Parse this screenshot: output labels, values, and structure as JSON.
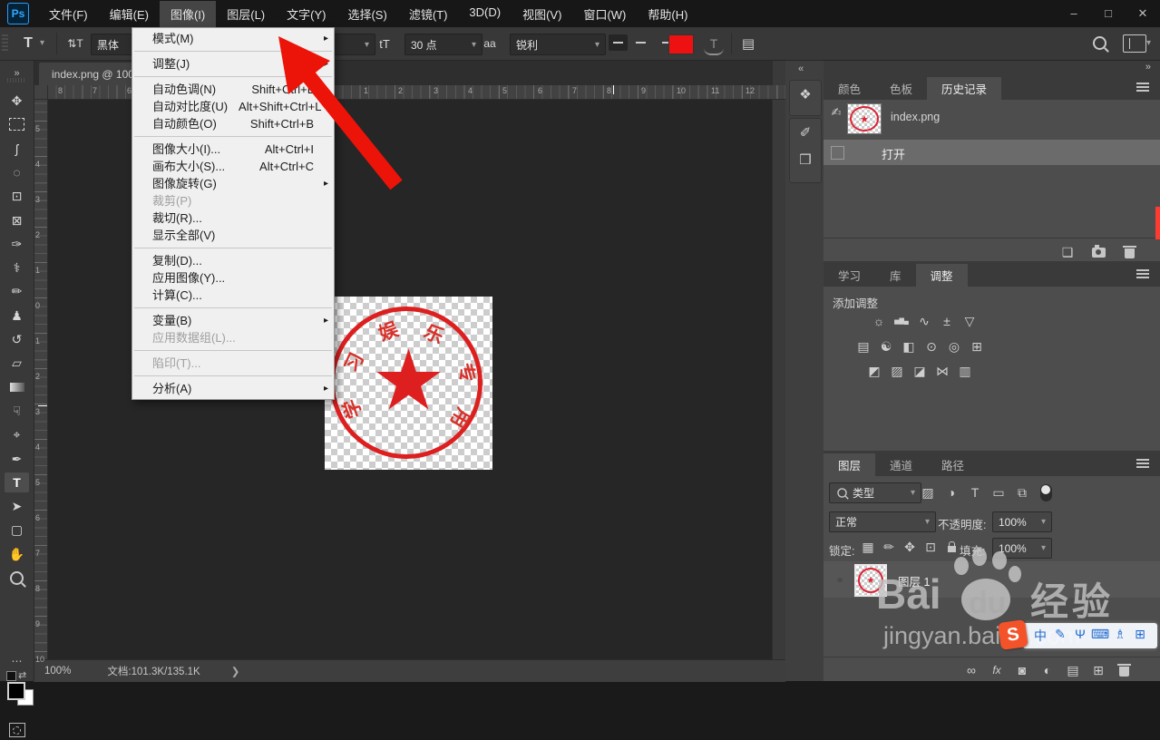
{
  "glyphs": {
    "chevron_down": "▾",
    "submenu_arrow": "▸",
    "dock_collapse": "«",
    "dock_expand": "»",
    "toolbar_collapse": "»",
    "ellipsis": "⋯",
    "swap": "⇄",
    "status_chevron": "❯"
  },
  "menubar": {
    "logo": "Ps",
    "items": [
      "文件(F)",
      "编辑(E)",
      "图像(I)",
      "图层(L)",
      "文字(Y)",
      "选择(S)",
      "滤镜(T)",
      "3D(D)",
      "视图(V)",
      "窗口(W)",
      "帮助(H)"
    ],
    "active_index": 2,
    "window_controls": {
      "minimize": "–",
      "maximize": "□",
      "close": "✕"
    }
  },
  "image_menu": {
    "items": [
      {
        "label": "模式(M)",
        "submenu": true
      },
      {
        "sep": true
      },
      {
        "label": "调整(J)",
        "submenu": true
      },
      {
        "sep": true
      },
      {
        "label": "自动色调(N)",
        "shortcut": "Shift+Ctrl+L"
      },
      {
        "label": "自动对比度(U)",
        "shortcut": "Alt+Shift+Ctrl+L"
      },
      {
        "label": "自动颜色(O)",
        "shortcut": "Shift+Ctrl+B"
      },
      {
        "sep": true
      },
      {
        "label": "图像大小(I)...",
        "shortcut": "Alt+Ctrl+I"
      },
      {
        "label": "画布大小(S)...",
        "shortcut": "Alt+Ctrl+C"
      },
      {
        "label": "图像旋转(G)",
        "submenu": true
      },
      {
        "label": "裁剪(P)",
        "disabled": true
      },
      {
        "label": "裁切(R)..."
      },
      {
        "label": "显示全部(V)"
      },
      {
        "sep": true
      },
      {
        "label": "复制(D)..."
      },
      {
        "label": "应用图像(Y)..."
      },
      {
        "label": "计算(C)..."
      },
      {
        "sep": true
      },
      {
        "label": "变量(B)",
        "submenu": true
      },
      {
        "label": "应用数据组(L)...",
        "disabled": true
      },
      {
        "sep": true
      },
      {
        "label": "陷印(T)...",
        "disabled": true
      },
      {
        "sep": true
      },
      {
        "label": "分析(A)",
        "submenu": true
      }
    ]
  },
  "options_bar": {
    "tool_icon": "T",
    "orientation_icon": "⇅T",
    "font_value": "黑体",
    "size_icon": "tT",
    "size_value": "30 点",
    "antialias_icon": "aa",
    "antialias_value": "锐利",
    "color_swatch": "#ee1111",
    "warp_icon": "T",
    "panels_icon": "▤"
  },
  "toolbar": {
    "tools": [
      {
        "name": "move-tool",
        "glyph": "✥"
      },
      {
        "name": "rectangular-marquee-tool",
        "shape": "marqic"
      },
      {
        "name": "lasso-tool",
        "glyph": "ʃ"
      },
      {
        "name": "quick-selection-tool",
        "glyph": "◌"
      },
      {
        "name": "crop-tool",
        "glyph": "⊡"
      },
      {
        "name": "frame-tool",
        "glyph": "⊠"
      },
      {
        "name": "eyedropper-tool",
        "glyph": "✑"
      },
      {
        "name": "spot-healing-brush-tool",
        "glyph": "⚕"
      },
      {
        "name": "brush-tool",
        "glyph": "✏"
      },
      {
        "name": "clone-stamp-tool",
        "glyph": "♟"
      },
      {
        "name": "history-brush-tool",
        "glyph": "↺"
      },
      {
        "name": "eraser-tool",
        "glyph": "▱"
      },
      {
        "name": "gradient-tool",
        "shape": "gradic"
      },
      {
        "name": "smudge-tool",
        "glyph": "☟"
      },
      {
        "name": "dodge-tool",
        "glyph": "⌖"
      },
      {
        "name": "pen-tool",
        "glyph": "✒"
      },
      {
        "name": "type-tool",
        "glyph": "T",
        "active": true
      },
      {
        "name": "path-selection-tool",
        "glyph": "➤"
      },
      {
        "name": "shape-tool",
        "glyph": "▢"
      },
      {
        "name": "hand-tool",
        "glyph": "✋"
      },
      {
        "name": "zoom-tool",
        "shape": "magic"
      }
    ]
  },
  "document": {
    "tab_title": "index.png @ 100",
    "ruler_h_left": [
      "8",
      "7",
      "6"
    ],
    "ruler_h_right": [
      "1",
      "2",
      "3",
      "4",
      "5",
      "6",
      "7",
      "8",
      "9",
      "10",
      "11",
      "12"
    ],
    "ruler_v": [
      "5",
      "4",
      "3",
      "2",
      "1",
      "0",
      "1",
      "2",
      "3",
      "4",
      "5",
      "6",
      "7",
      "8",
      "9",
      "10"
    ],
    "status": {
      "zoom": "100%",
      "doc_info": "文档:101.3K/135.1K"
    }
  },
  "canvas": {
    "star": "★",
    "stamp_color": "#dd1f1f",
    "stamp_chars": [
      {
        "ch": "学",
        "deg": 200
      },
      {
        "ch": "习",
        "deg": 155
      },
      {
        "ch": "娱",
        "deg": 110
      },
      {
        "ch": "乐",
        "deg": 65
      },
      {
        "ch": "专",
        "deg": 15
      },
      {
        "ch": "用",
        "deg": -30
      }
    ]
  },
  "strip_icons": [
    {
      "name": "properties-panel-icon",
      "glyph": "❖"
    },
    {
      "name": "brush-settings-panel-icon",
      "glyph": "✐"
    },
    {
      "name": "clone-source-panel-icon",
      "glyph": "❒"
    }
  ],
  "panels": {
    "history": {
      "tabs": [
        "颜色",
        "色板",
        "历史记录"
      ],
      "active_tab": 2,
      "snapshot_label": "index.png",
      "snapshot_brush_icon": "✍",
      "state_label": "打开",
      "footer_icons": [
        {
          "name": "new-doc-from-state-icon",
          "glyph": "❏"
        },
        {
          "name": "new-snapshot-camera-icon",
          "css": "cam"
        },
        {
          "name": "delete-state-trash-icon",
          "css": "trashic"
        }
      ]
    },
    "adjustments": {
      "tabs": [
        "学习",
        "库",
        "调整"
      ],
      "active_tab": 2,
      "header": "添加调整",
      "rows": [
        [
          {
            "name": "brightness-contrast-icon",
            "glyph": "☼"
          },
          {
            "name": "levels-icon",
            "glyph": "▅▇▄"
          },
          {
            "name": "curves-icon",
            "glyph": "∿"
          },
          {
            "name": "exposure-icon",
            "glyph": "±"
          },
          {
            "name": "vibrance-icon",
            "glyph": "▽"
          }
        ],
        [
          {
            "name": "hue-saturation-icon",
            "glyph": "▤"
          },
          {
            "name": "color-balance-icon",
            "glyph": "☯"
          },
          {
            "name": "black-white-icon",
            "glyph": "◧"
          },
          {
            "name": "photo-filter-icon",
            "glyph": "⊙"
          },
          {
            "name": "channel-mixer-icon",
            "glyph": "◎"
          },
          {
            "name": "color-lookup-icon",
            "glyph": "⊞"
          }
        ],
        [
          {
            "name": "invert-icon",
            "glyph": "◩"
          },
          {
            "name": "posterize-icon",
            "glyph": "▨"
          },
          {
            "name": "threshold-icon",
            "glyph": "◪"
          },
          {
            "name": "selective-color-icon",
            "glyph": "⋈"
          },
          {
            "name": "gradient-map-icon",
            "glyph": "▥"
          }
        ]
      ]
    },
    "layers": {
      "tabs": [
        "图层",
        "通道",
        "路径"
      ],
      "active_tab": 0,
      "filter_label": "类型",
      "filter_icons": [
        {
          "name": "pixel-layers-filter-icon",
          "glyph": "▨"
        },
        {
          "name": "adjustment-layers-filter-icon",
          "glyph": "◑"
        },
        {
          "name": "type-layers-filter-icon",
          "glyph": "T"
        },
        {
          "name": "shape-layers-filter-icon",
          "glyph": "▭"
        },
        {
          "name": "smart-object-filter-icon",
          "glyph": "⧉"
        },
        {
          "name": "layer-filter-toggle",
          "css": "pillic"
        }
      ],
      "blend_mode": "正常",
      "opacity_label": "不透明度:",
      "opacity_value": "100%",
      "lock_label": "锁定:",
      "lock_icons": [
        {
          "name": "lock-transparent-pixels-icon",
          "glyph": "▦"
        },
        {
          "name": "lock-image-pixels-icon",
          "glyph": "✏"
        },
        {
          "name": "lock-position-icon",
          "glyph": "✥"
        },
        {
          "name": "lock-artboard-icon",
          "glyph": "⊡"
        },
        {
          "name": "lock-all-icon",
          "css": "lockic"
        }
      ],
      "fill_label": "填充:",
      "fill_value": "100%",
      "layer_name": "图层 1",
      "footer_icons": [
        {
          "name": "link-layers-icon",
          "glyph": "∞"
        },
        {
          "name": "layer-style-fx-icon",
          "glyph": "fx"
        },
        {
          "name": "add-layer-mask-icon",
          "glyph": "◙"
        },
        {
          "name": "new-adjustment-layer-icon",
          "glyph": "◐"
        },
        {
          "name": "new-group-icon",
          "glyph": "▤"
        },
        {
          "name": "new-layer-icon",
          "glyph": "⊞"
        },
        {
          "name": "delete-layer-trash-icon",
          "css": "trashic"
        }
      ]
    }
  },
  "watermark": {
    "bai": "Bai",
    "du": "du",
    "jingyan": "经验",
    "url": "jingyan.baidu.com"
  },
  "ime": {
    "sogou": "S",
    "icons": [
      {
        "name": "ime-chinese-icon",
        "glyph": "中"
      },
      {
        "name": "ime-pen-icon",
        "glyph": "✎"
      },
      {
        "name": "ime-mic-icon",
        "glyph": "Ψ"
      },
      {
        "name": "ime-keyboard-icon",
        "glyph": "⌨"
      },
      {
        "name": "ime-skin-icon",
        "glyph": "♗"
      },
      {
        "name": "ime-menu-icon",
        "glyph": "⊞"
      }
    ]
  },
  "colors": {
    "arrow_red": "#ec1309",
    "swatch_red": "#ee1111",
    "stamp_red": "#dd1f1f",
    "ime_blue": "#1f6ad1",
    "sogou_orange": "#f4532a",
    "scroll_marker_red": "#ff3b30"
  }
}
